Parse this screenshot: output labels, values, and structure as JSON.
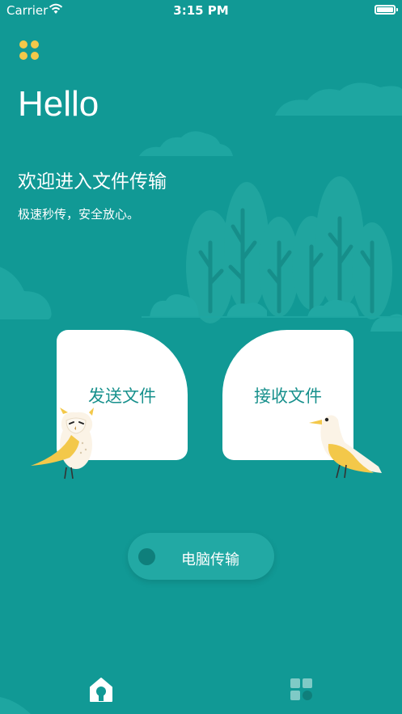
{
  "status_bar": {
    "carrier": "Carrier",
    "time": "3:15 PM"
  },
  "header": {
    "title": "Hello",
    "welcome": "欢迎进入文件传输",
    "tagline": "极速秒传，安全放心。"
  },
  "cards": {
    "send_label": "发送文件",
    "receive_label": "接收文件"
  },
  "pc_transfer": {
    "label": "电脑传输"
  },
  "tab_bar": {
    "tabs": [
      "home-icon",
      "grid-icon"
    ]
  },
  "colors": {
    "background": "#119995",
    "accent_yellow": "#f3c84a",
    "card_text": "#17908c"
  }
}
